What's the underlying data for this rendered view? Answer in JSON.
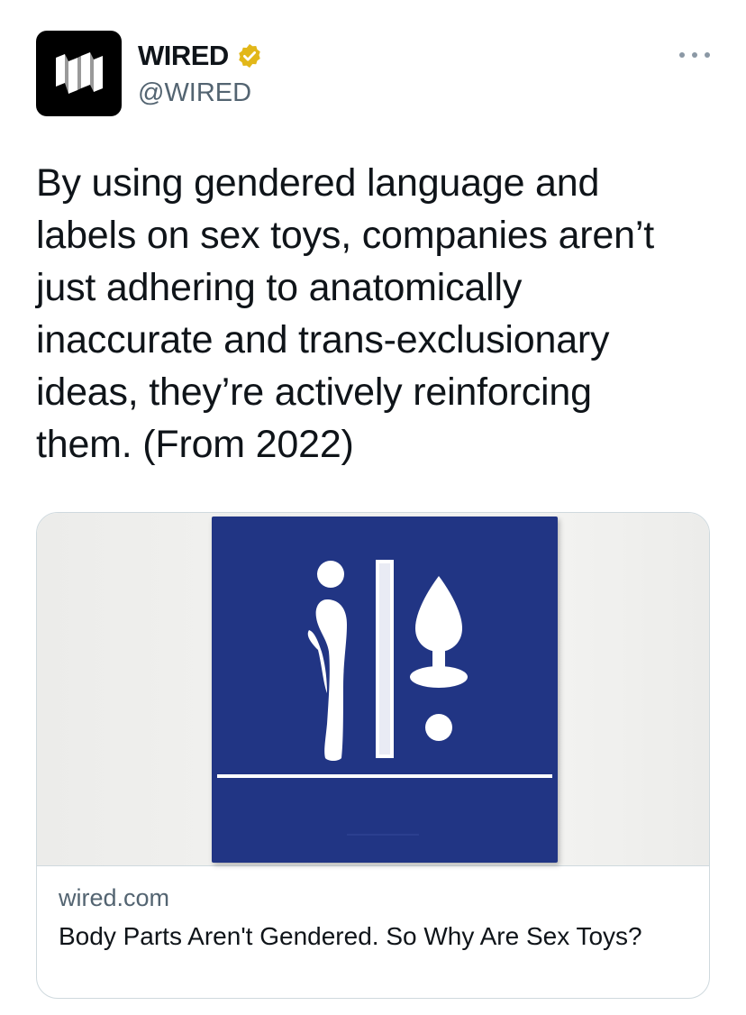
{
  "author": {
    "display_name": "WIRED",
    "handle": "@WIRED",
    "verified_badge_color": "#e2b719"
  },
  "icons": {
    "avatar": "wired-logo-icon",
    "verified": "verified-badge-icon",
    "more": "more-options-icon"
  },
  "tweet": {
    "text": "By using gendered language and\nlabels on sex toys, companies aren’t\njust adhering to anatomically\ninaccurate and trans-exclusionary\nideas, they’re actively reinforcing\nthem. (From 2022)"
  },
  "link_card": {
    "domain": "wired.com",
    "title": "Body Parts Aren't Gendered. So Why Are Sex Toys?",
    "sign_color": "#213584"
  }
}
